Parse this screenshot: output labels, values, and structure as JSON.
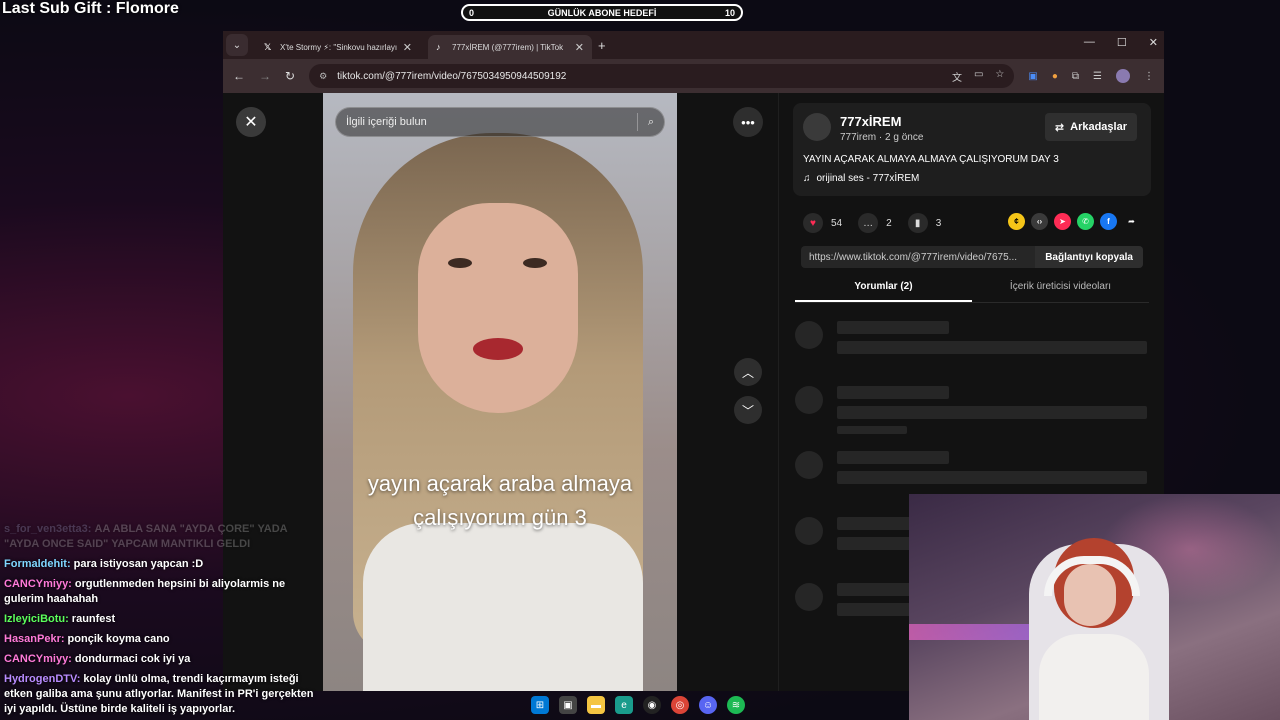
{
  "overlay": {
    "sub_gift": "Last Sub Gift : Flomore",
    "goal": {
      "title": "GÜNLÜK ABONE HEDEFİ",
      "current": "0",
      "target": "10"
    }
  },
  "browser": {
    "tabs": [
      {
        "favicon": "x-logo-icon",
        "title": "X'te Stormy ⚡: \"Sinkovu hazırlayın",
        "active": false
      },
      {
        "favicon": "tiktok-logo-icon",
        "title": "777xİREM (@777irem) | TikTok",
        "active": true
      }
    ],
    "url": "tiktok.com/@777irem/video/7675034950944509192"
  },
  "tiktok": {
    "search_placeholder": "İlgili içeriği bulun",
    "video_caption_line1": "yayın açarak araba almaya",
    "video_caption_line2": "çalışıyorum gün 3",
    "author": {
      "name": "777xİREM",
      "handle_meta": "777irem · 2 g önce",
      "friends_button": "Arkadaşlar"
    },
    "description": "YAYIN AÇARAK ALMAYA ALMAYA ÇALIŞIYORUM DAY 3",
    "music": "orijinal ses - 777xİREM",
    "stats": {
      "likes": "54",
      "comments": "2",
      "saves": "3"
    },
    "share_link": "https://www.tiktok.com/@777irem/video/7675...",
    "copy_link_button": "Bağlantıyı kopyala",
    "tabs": {
      "comments": "Yorumlar (2)",
      "creator_videos": "İçerik üreticisi videoları"
    }
  },
  "chat": [
    {
      "user": "s_for_ven3etta3:",
      "text": "AA ABLA SANA \"AYDA ÇORE\" YADA \"AYDA ONCE SAID\" YAPCAM MANTIKLI GELDI",
      "color": "#8888aa",
      "faded": true
    },
    {
      "user": "Formaldehit:",
      "text": "para istiyosan yapcan :D",
      "color": "#7fd6ff",
      "faded": false
    },
    {
      "user": "CANCYmiyy:",
      "text": "orgutlenmeden hepsini bi aliyolarmis ne gulerim haahahah",
      "color": "#ff7ad9",
      "faded": false
    },
    {
      "user": "IzleyiciBotu:",
      "text": "raunfest",
      "color": "#5cff5c",
      "faded": false
    },
    {
      "user": "HasanPekr:",
      "text": "ponçik koyma cano",
      "color": "#ff7ad9",
      "faded": false
    },
    {
      "user": "CANCYmiyy:",
      "text": "dondurmaci cok iyi ya",
      "color": "#ff7ad9",
      "faded": false
    },
    {
      "user": "HydrogenDTV:",
      "text": "kolay ünlü olma, trendi kaçırmayım isteği etken galiba ama şunu atlıyorlar. Manifest in PR'i gerçekten iyi yapıldı. Üstüne birde kaliteli iş yapıyorlar.",
      "color": "#b98cff",
      "faded": false
    }
  ],
  "colors": {
    "like": "#fe2c55",
    "windows_blue": "#0078d4",
    "spotify": "#1db954",
    "discord": "#5865f2"
  }
}
